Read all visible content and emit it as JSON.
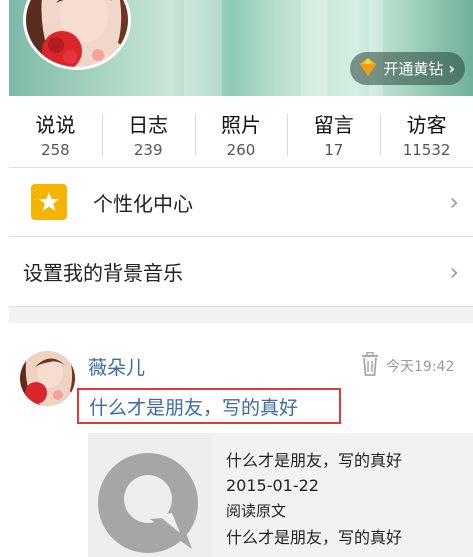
{
  "header": {
    "vip_button_label": "开通黄钻"
  },
  "stats": [
    {
      "label": "说说",
      "count": "258"
    },
    {
      "label": "日志",
      "count": "239"
    },
    {
      "label": "照片",
      "count": "260"
    },
    {
      "label": "留言",
      "count": "17"
    },
    {
      "label": "访客",
      "count": "11532"
    }
  ],
  "menu": {
    "personalize_label": "个性化中心",
    "bg_music_label": "设置我的背景音乐"
  },
  "feed": {
    "author": "薇朵儿",
    "time": "今天19:42",
    "text": "什么才是朋友，写的真好",
    "share": {
      "title": "什么才是朋友，写的真好",
      "date": "2015-01-22",
      "read_original": "阅读原文",
      "summary": "什么才是朋友，写的真好"
    }
  },
  "colors": {
    "accent_link": "#3b6aa6",
    "highlight_border": "#e23a3a",
    "personalize_icon_bg": "#f5b400"
  }
}
